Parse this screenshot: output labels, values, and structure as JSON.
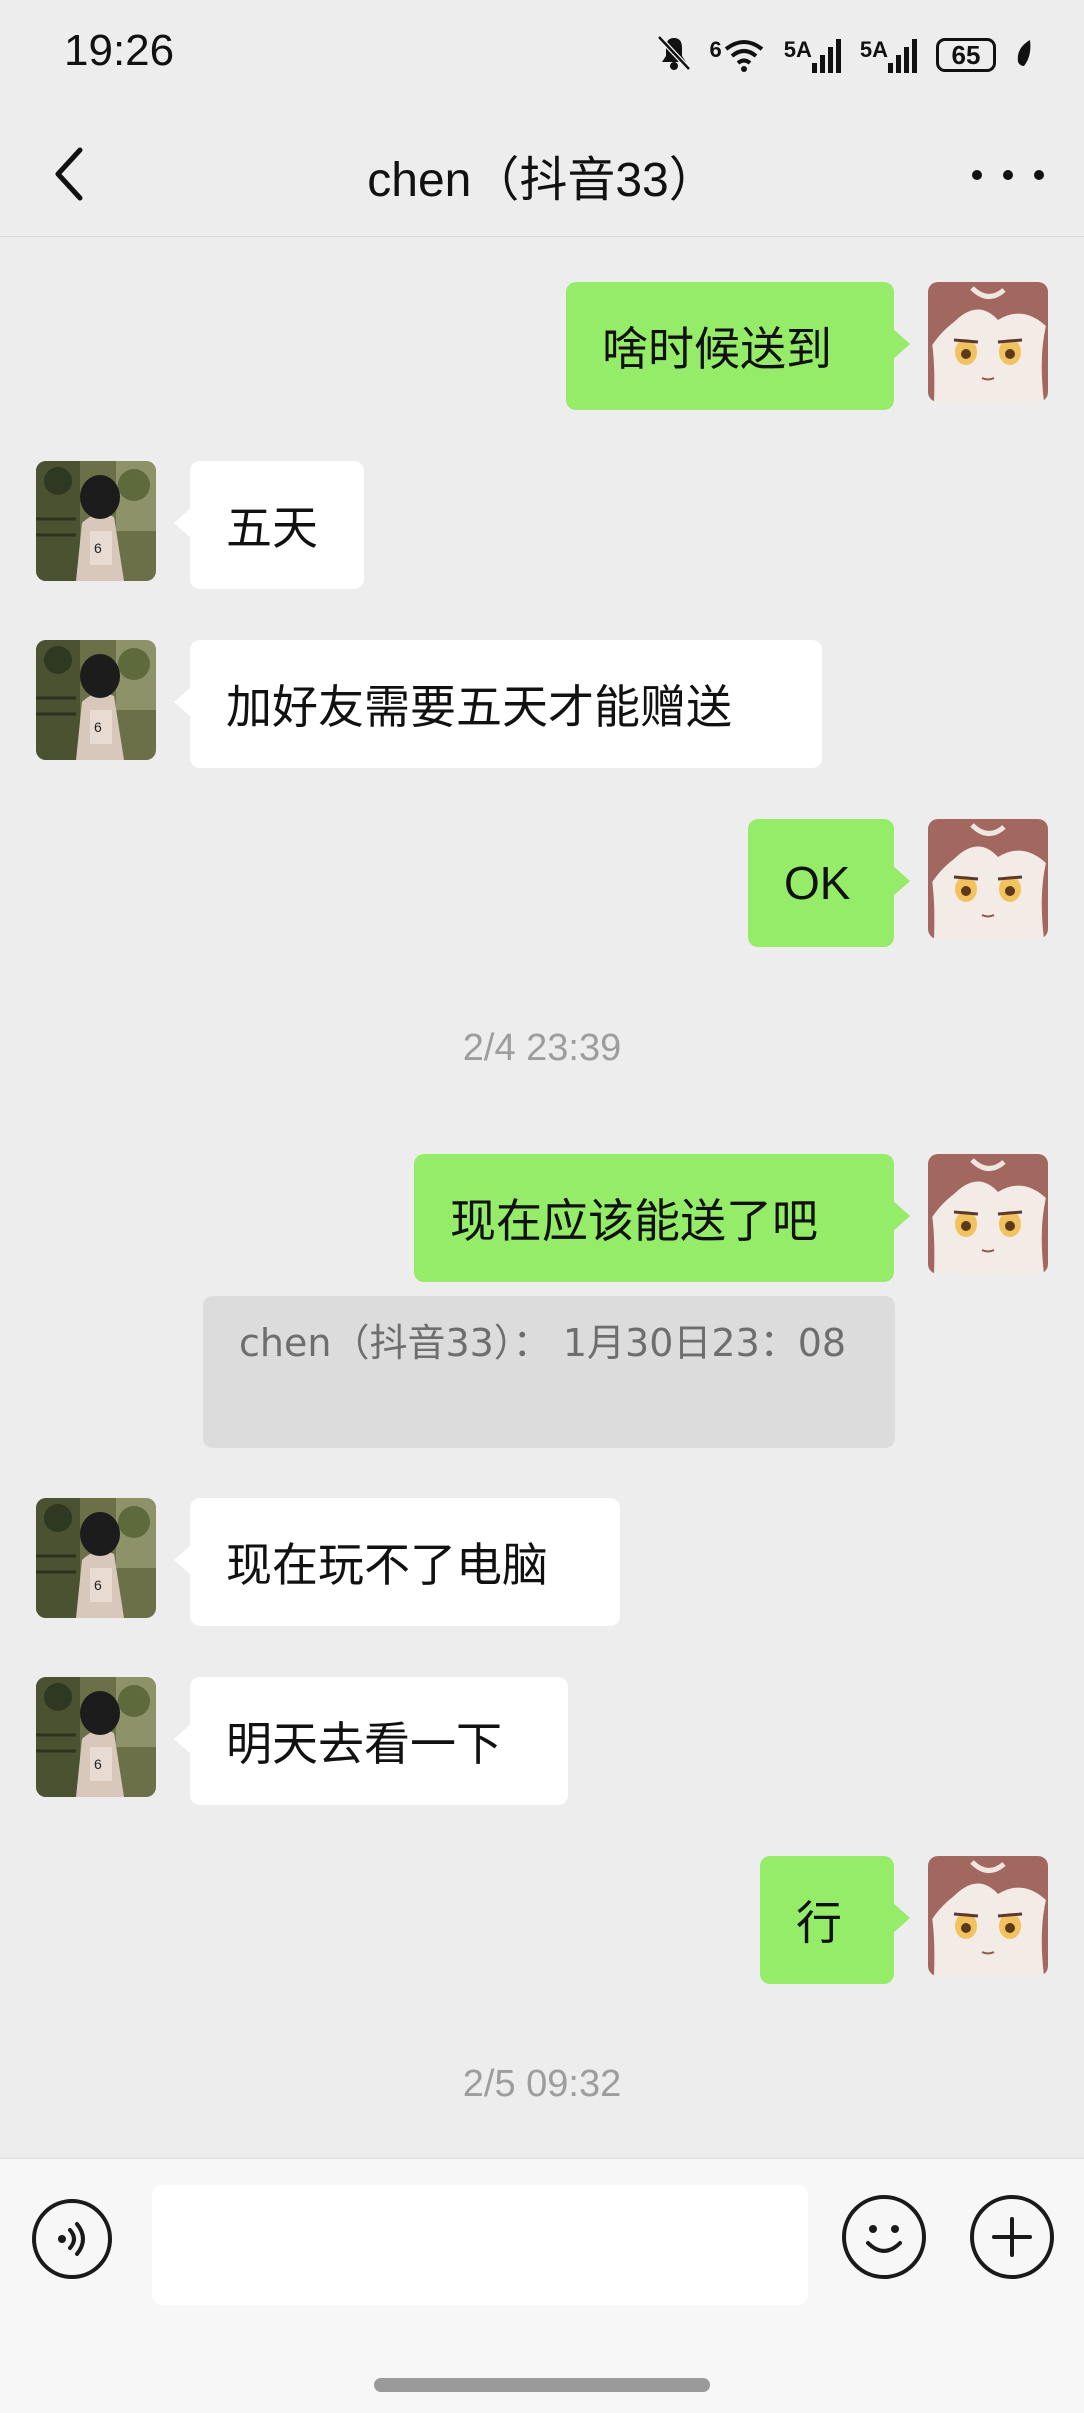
{
  "status_bar": {
    "time": "19:26",
    "icons": [
      "bell-off-icon",
      "wifi-icon",
      "signal-5a-icon",
      "signal-5a-icon",
      "battery-icon",
      "leaf-icon"
    ],
    "network_labels": [
      "6",
      "5A",
      "5A"
    ],
    "battery": "65"
  },
  "header": {
    "title": "chen（抖音33）",
    "back_icon": "chevron-left-icon",
    "more_icon": "more-dots-icon"
  },
  "messages": [
    {
      "sender": "me",
      "text": "啥时候送到"
    },
    {
      "sender": "other",
      "text": "五天"
    },
    {
      "sender": "other",
      "text": "加好友需要五天才能赠送"
    },
    {
      "sender": "me",
      "text": "OK"
    },
    {
      "type": "timestamp",
      "text": "2/4 23:39"
    },
    {
      "sender": "me",
      "text": "现在应该能送了吧"
    },
    {
      "type": "quote",
      "text": "chen（抖音33）：  1月30日23：08"
    },
    {
      "sender": "other",
      "text": "现在玩不了电脑"
    },
    {
      "sender": "other",
      "text": "明天去看一下"
    },
    {
      "sender": "me",
      "text": "行"
    },
    {
      "type": "timestamp",
      "text": "2/5 09:32"
    }
  ],
  "input_bar": {
    "voice_icon": "voice-icon",
    "input_value": "",
    "emoji_icon": "emoji-icon",
    "plus_icon": "plus-icon"
  },
  "colors": {
    "background": "#ededed",
    "my_bubble": "#95ec69",
    "other_bubble": "#ffffff",
    "timestamp_text": "#9d9d9d"
  }
}
